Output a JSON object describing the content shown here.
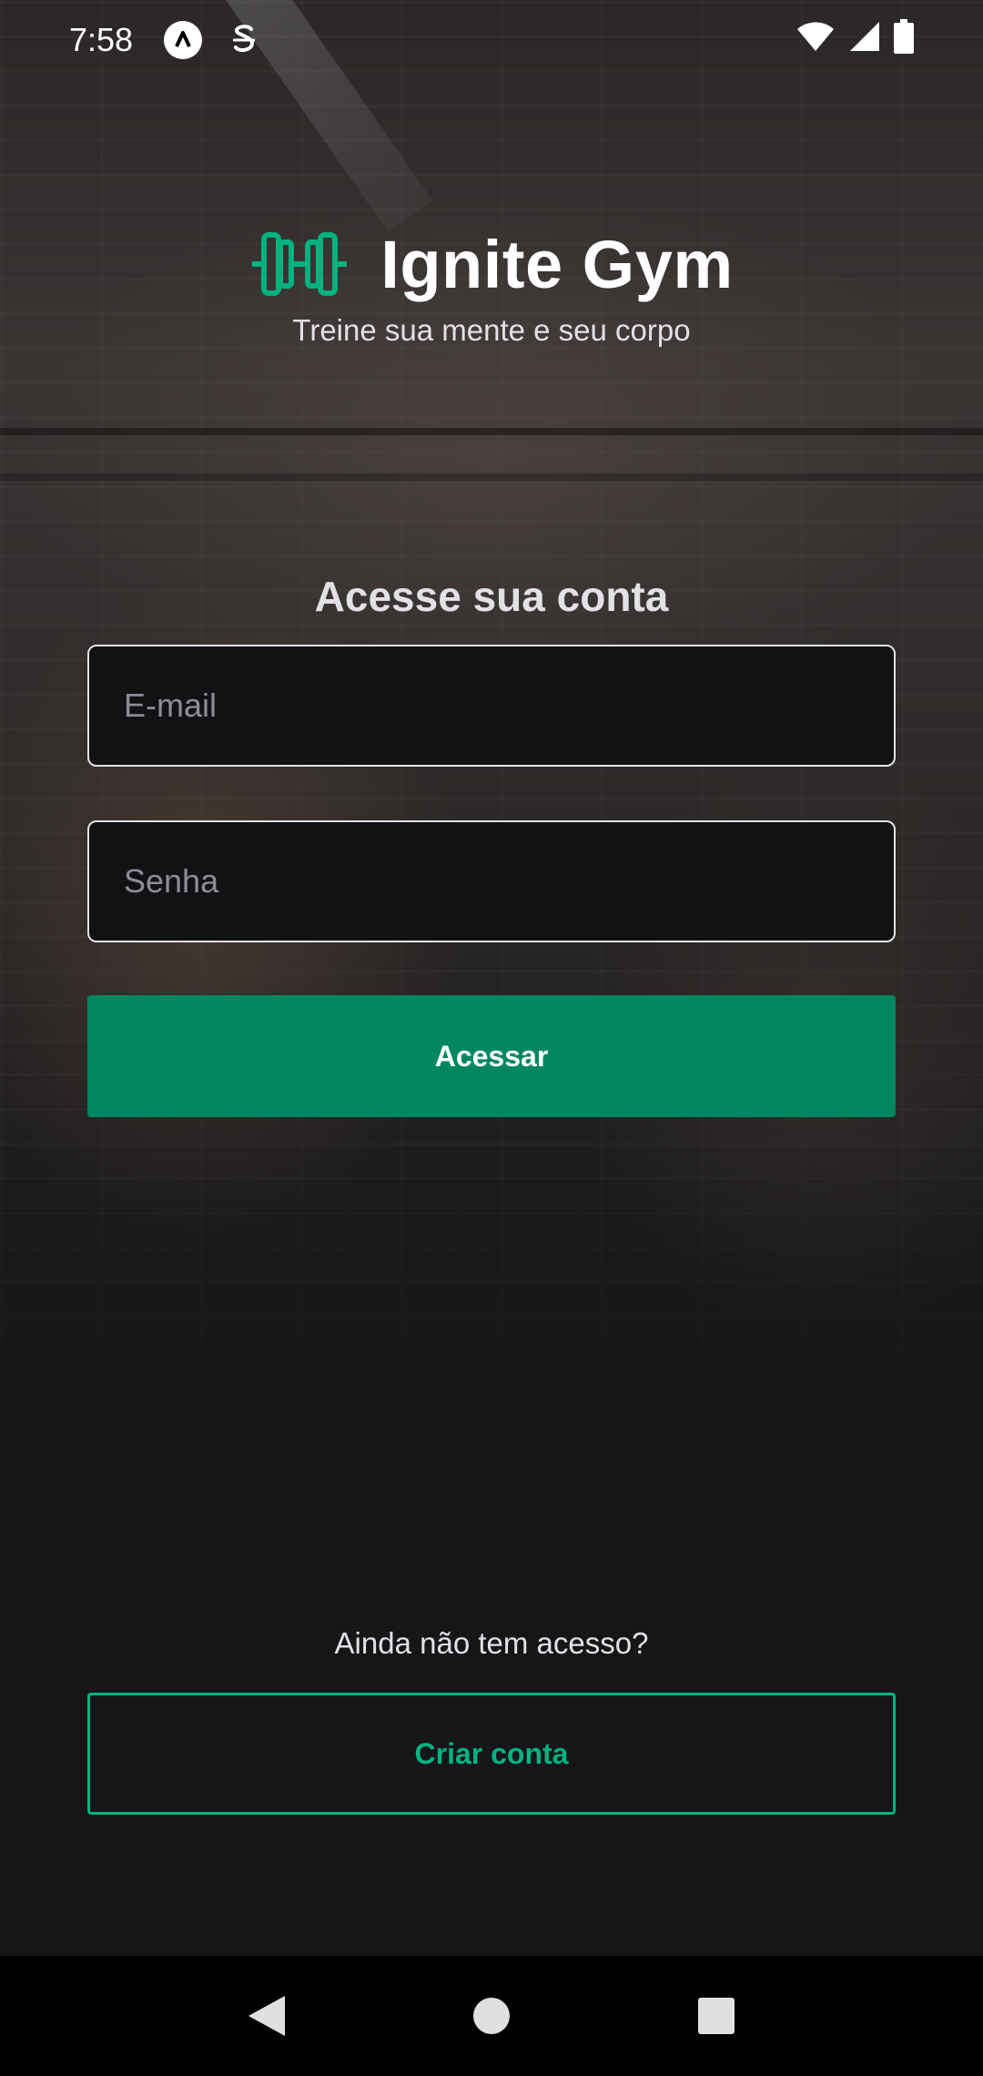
{
  "status_bar": {
    "time": "7:58",
    "icons": [
      "app-a-icon",
      "s-notification-icon",
      "wifi-icon",
      "signal-icon",
      "battery-icon"
    ]
  },
  "header": {
    "brand_name": "Ignite Gym",
    "tagline": "Treine sua mente e seu corpo",
    "logo_icon": "dumbbell-icon"
  },
  "login": {
    "title": "Acesse sua conta",
    "email_placeholder": "E-mail",
    "email_value": "",
    "password_placeholder": "Senha",
    "password_value": "",
    "submit_label": "Acessar"
  },
  "signup": {
    "prompt": "Ainda não tem acesso?",
    "button_label": "Criar conta"
  },
  "nav_bar": {
    "icons": [
      "back-icon",
      "home-icon",
      "recents-icon"
    ]
  },
  "colors": {
    "background": "#161618",
    "primary": "#00875F",
    "accent": "#00B37E",
    "input_bg": "#121214",
    "text": "#E1E1E6",
    "placeholder": "#8D8D99"
  }
}
